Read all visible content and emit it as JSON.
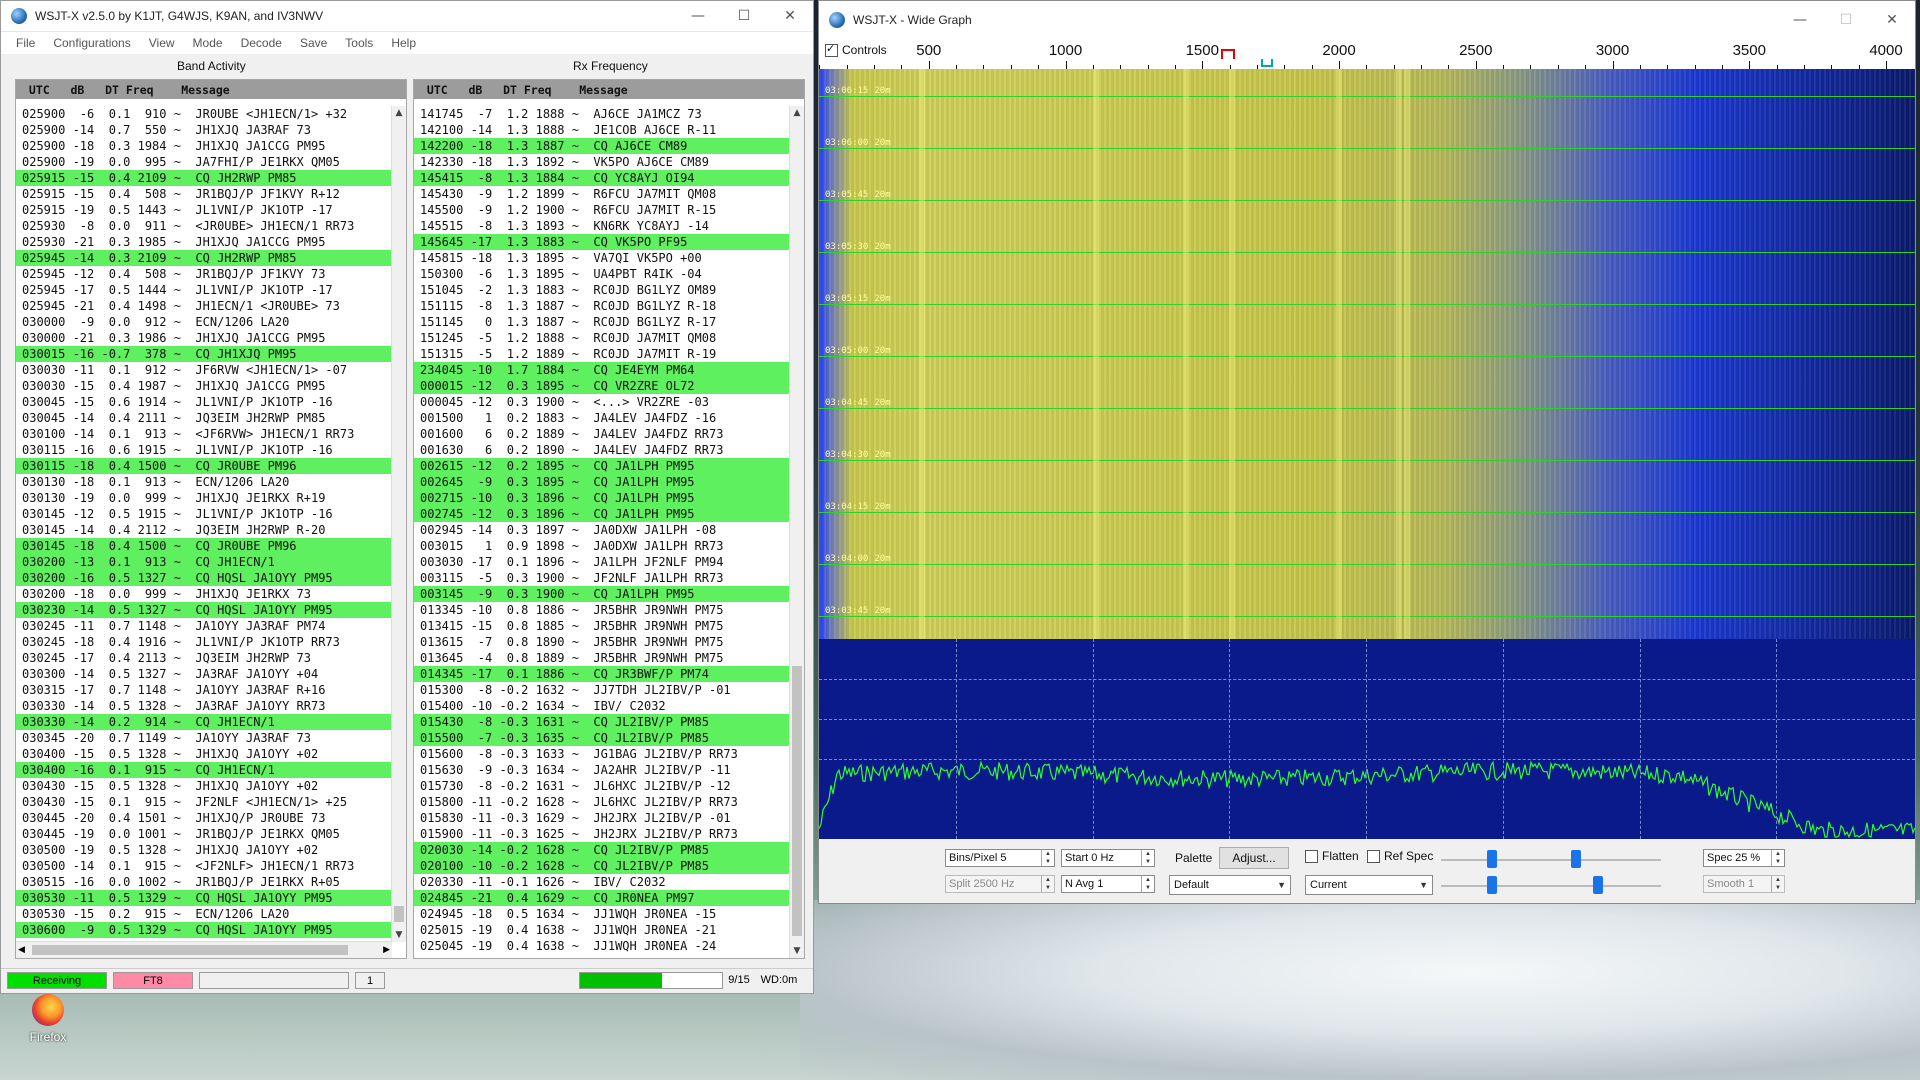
{
  "main_window": {
    "title": "WSJT-X   v2.5.0   by K1JT, G4WJS, K9AN, and IV3NWV",
    "menu": [
      "File",
      "Configurations",
      "View",
      "Mode",
      "Decode",
      "Save",
      "Tools",
      "Help"
    ],
    "band_activity": {
      "title": "Band Activity",
      "header": " UTC   dB   DT Freq    Message",
      "rows": [
        {
          "text": "025900  -6  0.1  910 ~  JR0UBE <JH1ECN/1> +32",
          "cq": false
        },
        {
          "text": "025900 -14  0.7  550 ~  JH1XJQ JA3RAF 73",
          "cq": false
        },
        {
          "text": "025900 -18  0.3 1984 ~  JH1XJQ JA1CCG PM95",
          "cq": false
        },
        {
          "text": "025900 -19  0.0  995 ~  JA7FHI/P JE1RKX QM05",
          "cq": false
        },
        {
          "text": "025915 -15  0.4 2109 ~  CQ JH2RWP PM85",
          "cq": true
        },
        {
          "text": "025915 -15  0.4  508 ~  JR1BQJ/P JF1KVY R+12",
          "cq": false
        },
        {
          "text": "025915 -19  0.5 1443 ~  JL1VNI/P JK1OTP -17",
          "cq": false
        },
        {
          "text": "025930  -8  0.0  911 ~  <JR0UBE> JH1ECN/1 RR73",
          "cq": false
        },
        {
          "text": "025930 -21  0.3 1985 ~  JH1XJQ JA1CCG PM95",
          "cq": false
        },
        {
          "text": "025945 -14  0.3 2109 ~  CQ JH2RWP PM85",
          "cq": true
        },
        {
          "text": "025945 -12  0.4  508 ~  JR1BQJ/P JF1KVY 73",
          "cq": false
        },
        {
          "text": "025945 -17  0.5 1444 ~  JL1VNI/P JK1OTP -17",
          "cq": false
        },
        {
          "text": "025945 -21  0.4 1498 ~  JH1ECN/1 <JR0UBE> 73",
          "cq": false
        },
        {
          "text": "030000  -9  0.0  912 ~  ECN/1206 LA20",
          "cq": false
        },
        {
          "text": "030000 -21  0.3 1986 ~  JH1XJQ JA1CCG PM95",
          "cq": false
        },
        {
          "text": "030015 -16 -0.7  378 ~  CQ JH1XJQ PM95",
          "cq": true
        },
        {
          "text": "030030 -11  0.1  912 ~  JF6RVW <JH1ECN/1> -07",
          "cq": false
        },
        {
          "text": "030030 -15  0.4 1987 ~  JH1XJQ JA1CCG PM95",
          "cq": false
        },
        {
          "text": "030045 -15  0.6 1914 ~  JL1VNI/P JK1OTP -16",
          "cq": false
        },
        {
          "text": "030045 -14  0.4 2111 ~  JQ3EIM JH2RWP PM85",
          "cq": false
        },
        {
          "text": "030100 -14  0.1  913 ~  <JF6RVW> JH1ECN/1 RR73",
          "cq": false
        },
        {
          "text": "030115 -16  0.6 1915 ~  JL1VNI/P JK1OTP -16",
          "cq": false
        },
        {
          "text": "030115 -18  0.4 1500 ~  CQ JR0UBE PM96",
          "cq": true
        },
        {
          "text": "030130 -18  0.1  913 ~  ECN/1206 LA20",
          "cq": false
        },
        {
          "text": "030130 -19  0.0  999 ~  JH1XJQ JE1RKX R+19",
          "cq": false
        },
        {
          "text": "030145 -12  0.5 1915 ~  JL1VNI/P JK1OTP -16",
          "cq": false
        },
        {
          "text": "030145 -14  0.4 2112 ~  JQ3EIM JH2RWP R-20",
          "cq": false
        },
        {
          "text": "030145 -18  0.4 1500 ~  CQ JR0UBE PM96",
          "cq": true
        },
        {
          "text": "030200 -13  0.1  913 ~  CQ JH1ECN/1",
          "cq": true
        },
        {
          "text": "030200 -16  0.5 1327 ~  CQ HQSL JA1OYY PM95",
          "cq": true
        },
        {
          "text": "030200 -18  0.0  999 ~  JH1XJQ JE1RKX 73",
          "cq": false
        },
        {
          "text": "030230 -14  0.5 1327 ~  CQ HQSL JA1OYY PM95",
          "cq": true
        },
        {
          "text": "030245 -11  0.7 1148 ~  JA1OYY JA3RAF PM74",
          "cq": false
        },
        {
          "text": "030245 -18  0.4 1916 ~  JL1VNI/P JK1OTP RR73",
          "cq": false
        },
        {
          "text": "030245 -17  0.4 2113 ~  JQ3EIM JH2RWP 73",
          "cq": false
        },
        {
          "text": "030300 -14  0.5 1327 ~  JA3RAF JA1OYY +04",
          "cq": false
        },
        {
          "text": "030315 -17  0.7 1148 ~  JA1OYY JA3RAF R+16",
          "cq": false
        },
        {
          "text": "030330 -14  0.5 1328 ~  JA3RAF JA1OYY RR73",
          "cq": false
        },
        {
          "text": "030330 -14  0.2  914 ~  CQ JH1ECN/1",
          "cq": true
        },
        {
          "text": "030345 -20  0.7 1149 ~  JA1OYY JA3RAF 73",
          "cq": false
        },
        {
          "text": "030400 -15  0.5 1328 ~  JH1XJQ JA1OYY +02",
          "cq": false
        },
        {
          "text": "030400 -16  0.1  915 ~  CQ JH1ECN/1",
          "cq": true
        },
        {
          "text": "030430 -15  0.5 1328 ~  JH1XJQ JA1OYY +02",
          "cq": false
        },
        {
          "text": "030430 -15  0.1  915 ~  JF2NLF <JH1ECN/1> +25",
          "cq": false
        },
        {
          "text": "030445 -20  0.4 1501 ~  JH1XJQ/P JR0UBE 73",
          "cq": false
        },
        {
          "text": "030445 -19  0.0 1001 ~  JR1BQJ/P JE1RKX QM05",
          "cq": false
        },
        {
          "text": "030500 -19  0.5 1328 ~  JH1XJQ JA1OYY +02",
          "cq": false
        },
        {
          "text": "030500 -14  0.1  915 ~  <JF2NLF> JH1ECN/1 RR73",
          "cq": false
        },
        {
          "text": "030515 -16  0.0 1002 ~  JR1BQJ/P JE1RKX R+05",
          "cq": false
        },
        {
          "text": "030530 -11  0.5 1329 ~  CQ HQSL JA1OYY PM95",
          "cq": true
        },
        {
          "text": "030530 -15  0.2  915 ~  ECN/1206 LA20",
          "cq": false
        },
        {
          "text": "030600  -9  0.5 1329 ~  CQ HQSL JA1OYY PM95",
          "cq": true
        }
      ]
    },
    "rx_frequency": {
      "title": "Rx Frequency",
      "header": " UTC   dB   DT Freq    Message",
      "rows": [
        {
          "text": "141745  -7  1.2 1888 ~  AJ6CE JA1MCZ 73",
          "cq": false
        },
        {
          "text": "142100 -14  1.3 1888 ~  JE1COB AJ6CE R-11",
          "cq": false
        },
        {
          "text": "142200 -18  1.3 1887 ~  CQ AJ6CE CM89",
          "cq": true
        },
        {
          "text": "142330 -18  1.3 1892 ~  VK5PO AJ6CE CM89",
          "cq": false
        },
        {
          "text": "145415  -8  1.3 1884 ~  CQ YC8AYJ OI94",
          "cq": true
        },
        {
          "text": "145430  -9  1.2 1899 ~  R6FCU JA7MIT QM08",
          "cq": false
        },
        {
          "text": "145500  -9  1.2 1900 ~  R6FCU JA7MIT R-15",
          "cq": false
        },
        {
          "text": "145515  -8  1.3 1893 ~  KN6RK YC8AYJ -14",
          "cq": false
        },
        {
          "text": "145645 -17  1.3 1883 ~  CQ VK5PO PF95",
          "cq": true
        },
        {
          "text": "145815 -18  1.3 1895 ~  VA7QI VK5PO +00",
          "cq": false
        },
        {
          "text": "150300  -6  1.3 1895 ~  UA4PBT R4IK -04",
          "cq": false
        },
        {
          "text": "151045  -2  1.3 1883 ~  RC0JD BG1LYZ OM89",
          "cq": false
        },
        {
          "text": "151115  -8  1.3 1887 ~  RC0JD BG1LYZ R-18",
          "cq": false
        },
        {
          "text": "151145   0  1.3 1887 ~  RC0JD BG1LYZ R-17",
          "cq": false
        },
        {
          "text": "151245  -5  1.2 1888 ~  RC0JD JA7MIT QM08",
          "cq": false
        },
        {
          "text": "151315  -5  1.2 1889 ~  RC0JD JA7MIT R-19",
          "cq": false
        },
        {
          "text": "234045 -10  1.7 1884 ~  CQ JE4EYM PM64",
          "cq": true
        },
        {
          "text": "000015 -12  0.3 1895 ~  CQ VR2ZRE OL72",
          "cq": true
        },
        {
          "text": "000045 -12  0.3 1900 ~  <...> VR2ZRE -03",
          "cq": false
        },
        {
          "text": "001500   1  0.2 1883 ~  JA4LEV JA4FDZ -16",
          "cq": false
        },
        {
          "text": "001600   6  0.2 1889 ~  JA4LEV JA4FDZ RR73",
          "cq": false
        },
        {
          "text": "001630   6  0.2 1890 ~  JA4LEV JA4FDZ RR73",
          "cq": false
        },
        {
          "text": "002615 -12  0.2 1895 ~  CQ JA1LPH PM95",
          "cq": true
        },
        {
          "text": "002645  -9  0.3 1895 ~  CQ JA1LPH PM95",
          "cq": true
        },
        {
          "text": "002715 -10  0.3 1896 ~  CQ JA1LPH PM95",
          "cq": true
        },
        {
          "text": "002745 -12  0.3 1896 ~  CQ JA1LPH PM95",
          "cq": true
        },
        {
          "text": "002945 -14  0.3 1897 ~  JA0DXW JA1LPH -08",
          "cq": false
        },
        {
          "text": "003015   1  0.9 1898 ~  JA0DXW JA1LPH RR73",
          "cq": false
        },
        {
          "text": "003030 -17  0.1 1896 ~  JA1LPH JF2NLF PM94",
          "cq": false
        },
        {
          "text": "003115  -5  0.3 1900 ~  JF2NLF JA1LPH RR73",
          "cq": false
        },
        {
          "text": "003145  -9  0.3 1900 ~  CQ JA1LPH PM95",
          "cq": true
        },
        {
          "text": "013345 -10  0.8 1886 ~  JR5BHR JR9NWH PM75",
          "cq": false
        },
        {
          "text": "013415 -15  0.8 1885 ~  JR5BHR JR9NWH PM75",
          "cq": false
        },
        {
          "text": "013615  -7  0.8 1890 ~  JR5BHR JR9NWH PM75",
          "cq": false
        },
        {
          "text": "013645  -4  0.8 1889 ~  JR5BHR JR9NWH PM75",
          "cq": false
        },
        {
          "text": "014345 -17  0.1 1886 ~  CQ JR3BWF/P PM74",
          "cq": true
        },
        {
          "text": "015300  -8 -0.2 1632 ~  JJ7TDH JL2IBV/P -01",
          "cq": false
        },
        {
          "text": "015400 -10 -0.2 1634 ~  IBV/ C2032",
          "cq": false
        },
        {
          "text": "015430  -8 -0.3 1631 ~  CQ JL2IBV/P PM85",
          "cq": true
        },
        {
          "text": "015500  -7 -0.3 1635 ~  CQ JL2IBV/P PM85",
          "cq": true
        },
        {
          "text": "015600  -8 -0.3 1633 ~  JG1BAG JL2IBV/P RR73",
          "cq": false
        },
        {
          "text": "015630  -9 -0.3 1634 ~  JA2AHR JL2IBV/P -11",
          "cq": false
        },
        {
          "text": "015730  -8 -0.2 1631 ~  JL6HXC JL2IBV/P -12",
          "cq": false
        },
        {
          "text": "015800 -11 -0.2 1628 ~  JL6HXC JL2IBV/P RR73",
          "cq": false
        },
        {
          "text": "015830 -11 -0.3 1629 ~  JH2JRX JL2IBV/P -01",
          "cq": false
        },
        {
          "text": "015900 -11 -0.3 1625 ~  JH2JRX JL2IBV/P RR73",
          "cq": false
        },
        {
          "text": "020030 -14 -0.2 1628 ~  CQ JL2IBV/P PM85",
          "cq": true
        },
        {
          "text": "020100 -10 -0.2 1628 ~  CQ JL2IBV/P PM85",
          "cq": true
        },
        {
          "text": "020330 -11 -0.1 1626 ~  IBV/ C2032",
          "cq": false
        },
        {
          "text": "024845 -21  0.4 1629 ~  CQ JR0NEA PM97",
          "cq": true
        },
        {
          "text": "024945 -18  0.5 1634 ~  JJ1WQH JR0NEA -15",
          "cq": false
        },
        {
          "text": "025015 -19  0.4 1638 ~  JJ1WQH JR0NEA -21",
          "cq": false
        },
        {
          "text": "025045 -19  0.4 1638 ~  JJ1WQH JR0NEA -24",
          "cq": false
        }
      ]
    },
    "status": {
      "receiving": "Receiving",
      "mode": "FT8",
      "blank": "",
      "count": "1",
      "progress": 0.58,
      "period": "9/15",
      "wd": "WD:0m"
    },
    "colors": {
      "cq_highlight": "#5ff05f",
      "receiving_bg": "#00e000",
      "mode_bg": "#ff8aa8",
      "progress_fill": "#00c000"
    }
  },
  "wide_graph": {
    "title": "WSJT-X - Wide Graph",
    "controls_label": "Controls",
    "controls_checked": true,
    "freq_ticks": [
      "500",
      "1000",
      "1500",
      "2000",
      "2500",
      "3000",
      "3500",
      "4000"
    ],
    "time_labels": [
      "03:06:15",
      "03:06:00",
      "03:05:45",
      "03:05:30",
      "03:05:15",
      "03:05:00",
      "03:04:45",
      "03:04:30",
      "03:04:15",
      "03:04:00",
      "03:03:45"
    ],
    "band_label": "20m",
    "bins_per_pixel": "Bins/Pixel  5",
    "start": "Start  0 Hz",
    "palette_label": "Palette",
    "adjust_label": "Adjust...",
    "flatten_label": "Flatten",
    "ref_spec_label": "Ref Spec",
    "spec": "Spec  25 %",
    "split": "Split   2500  Hz",
    "n_avg": "N Avg  1",
    "palette_value": "Default",
    "spectrum_mode": "Current",
    "smooth": "Smooth   1"
  },
  "desktop": {
    "firefox_label": "Firefox"
  }
}
